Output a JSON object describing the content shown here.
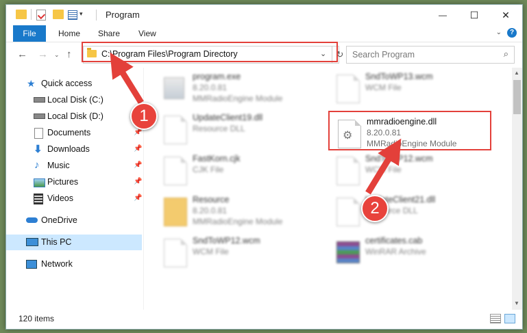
{
  "window": {
    "title": "Program",
    "controls": {
      "minimize": "—",
      "maximize": "☐",
      "close": "✕"
    }
  },
  "ribbon": {
    "tabs": [
      "File",
      "Home",
      "Share",
      "View"
    ],
    "help": "?"
  },
  "address_bar": {
    "path": "C:\\Program Files\\Program Directory",
    "refresh_icon": "↻"
  },
  "search": {
    "placeholder": "Search Program"
  },
  "sidebar": {
    "items": [
      {
        "label": "Quick access",
        "icon": "star-icon",
        "pinned": false
      },
      {
        "label": "Local Disk (C:)",
        "icon": "drive-icon",
        "pinned": false
      },
      {
        "label": "Local Disk (D:)",
        "icon": "drive-icon",
        "pinned": false
      },
      {
        "label": "Documents",
        "icon": "documents-icon",
        "pinned": true
      },
      {
        "label": "Downloads",
        "icon": "download-icon",
        "pinned": true
      },
      {
        "label": "Music",
        "icon": "music-icon",
        "pinned": true
      },
      {
        "label": "Pictures",
        "icon": "pictures-icon",
        "pinned": true
      },
      {
        "label": "Videos",
        "icon": "videos-icon",
        "pinned": true
      },
      {
        "label": "OneDrive",
        "icon": "cloud-icon",
        "pinned": false
      },
      {
        "label": "This PC",
        "icon": "computer-icon",
        "pinned": false,
        "selected": true
      },
      {
        "label": "Network",
        "icon": "network-icon",
        "pinned": false
      }
    ]
  },
  "files": {
    "left": [
      {
        "name": "program.exe",
        "line1": "8.20.0.81",
        "line2": "MMRadioEngine Module"
      },
      {
        "name": "UpdateClient19.dll",
        "line1": "Resource DLL",
        "line2": ""
      },
      {
        "name": "FastKorn.cjk",
        "line1": "CJK File",
        "line2": ""
      },
      {
        "name": "Resource",
        "line1": "8.20.0.81",
        "line2": "MMRadioEngine Module"
      },
      {
        "name": "SndToWP12.wcm",
        "line1": "WCM File",
        "line2": ""
      }
    ],
    "right": [
      {
        "name": "SndToWP13.wcm",
        "line1": "WCM File",
        "line2": ""
      },
      {
        "name": "mmradioengine.dll",
        "line1": "8.20.0.81",
        "line2": "MMRadioEngine Module"
      },
      {
        "name": "SndToWP12.wcm",
        "line1": "WCM File",
        "line2": ""
      },
      {
        "name": "UpdateClient21.dll",
        "line1": "Resource DLL",
        "line2": ""
      },
      {
        "name": "certificates.cab",
        "line1": "WinRAR Archive",
        "line2": ""
      }
    ]
  },
  "status": {
    "items_count": "120 items"
  },
  "annotations": {
    "step1": "1",
    "step2": "2",
    "color": "#e3403a"
  }
}
